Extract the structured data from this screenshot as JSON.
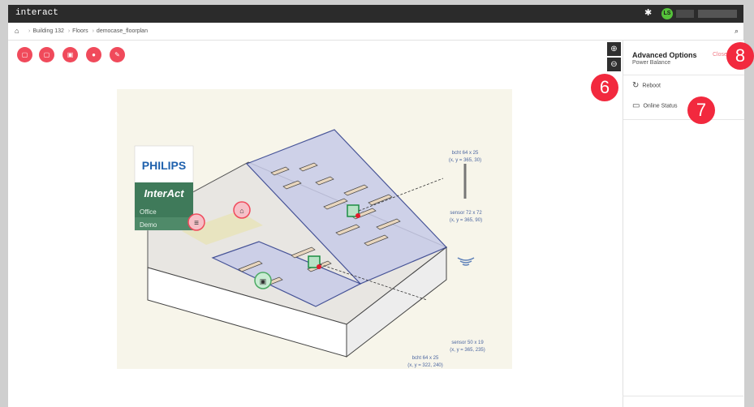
{
  "app": {
    "title": "interact"
  },
  "user": {
    "initials": "LS"
  },
  "breadcrumb": [
    "Building 132",
    "Floors",
    "democase_floorplan"
  ],
  "toolbar": {
    "tools": [
      "square-icon",
      "square-icon",
      "save-icon",
      "user-icon",
      "edit-icon"
    ]
  },
  "floorplan": {
    "brand": "PHILIPS",
    "product": "InterAct",
    "tags": [
      "Office",
      "Demo"
    ],
    "annotations": [
      {
        "label": "bcht 64 x 25",
        "coords": "(x, y = 365, 30)"
      },
      {
        "label": "sensor 72 x 72",
        "coords": "(x, y = 365, 90)"
      },
      {
        "label": "sensor 50 x 19",
        "coords": "(x, y = 365, 235)"
      },
      {
        "label": "bcht 64 x 25",
        "coords": "(x, y = 322, 240)"
      }
    ]
  },
  "panel": {
    "title": "Advanced Options",
    "subtitle": "Power Balance",
    "close_label": "Close",
    "actions": [
      {
        "icon": "refresh-icon",
        "label": "Reboot"
      },
      {
        "icon": "device-status-icon",
        "label": "Online Status"
      }
    ]
  },
  "steps": [
    "6",
    "7",
    "8"
  ],
  "colors": {
    "accent": "#f04a5b",
    "step": "#f2293e",
    "topbar": "#2b2b2b",
    "philips_blue": "#1f61ad",
    "interact_green": "#3f7a5a"
  }
}
